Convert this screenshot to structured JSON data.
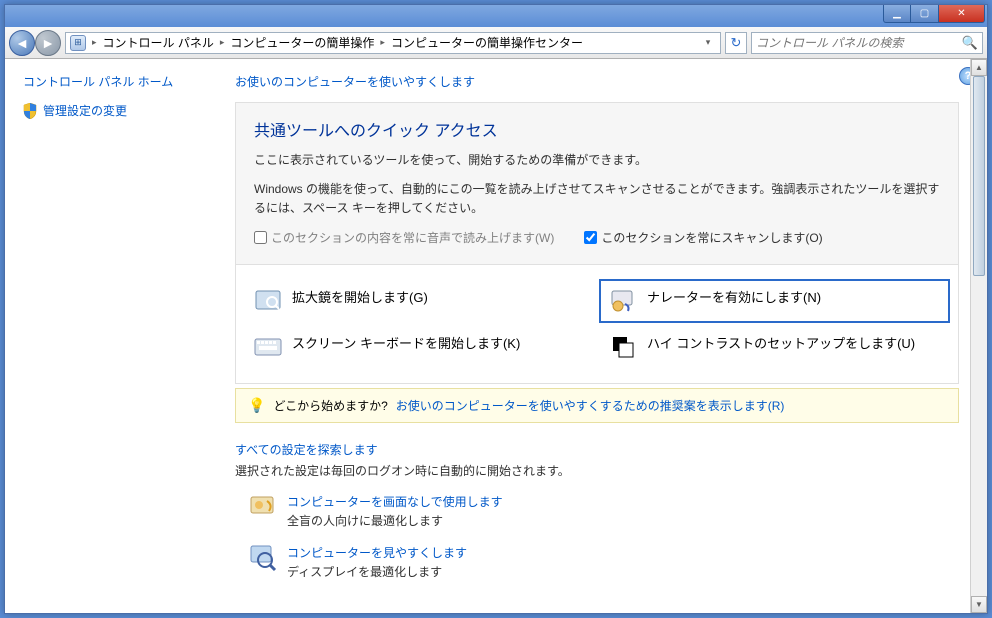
{
  "titlebar": {},
  "breadcrumb": {
    "root": "コントロール パネル",
    "level1": "コンピューターの簡単操作",
    "level2": "コンピューターの簡単操作センター"
  },
  "search": {
    "placeholder": "コントロール パネルの検索"
  },
  "sidebar": {
    "home": "コントロール パネル ホーム",
    "admin": "管理設定の変更"
  },
  "main": {
    "intro": "お使いのコンピューターを使いやすくします",
    "quick": {
      "title": "共通ツールへのクイック アクセス",
      "desc1": "ここに表示されているツールを使って、開始するための準備ができます。",
      "desc2": "Windows の機能を使って、自動的にこの一覧を読み上げさせてスキャンさせることができます。強調表示されたツールを選択するには、スペース キーを押してください。",
      "chk_voice": "このセクションの内容を常に音声で読み上げます(W)",
      "chk_scan": "このセクションを常にスキャンします(O)"
    },
    "tools": {
      "magnifier": "拡大鏡を開始します(G)",
      "narrator": "ナレーターを有効にします(N)",
      "osk": "スクリーン キーボードを開始します(K)",
      "contrast": "ハイ コントラストのセットアップをします(U)"
    },
    "hint": {
      "q": "どこから始めますか?",
      "link": "お使いのコンピューターを使いやすくするための推奨案を表示します(R)"
    },
    "explore": {
      "title": "すべての設定を探索します",
      "desc": "選択された設定は毎回のログオン時に自動的に開始されます。",
      "nodisplay": {
        "link": "コンピューターを画面なしで使用します",
        "sub": "全盲の人向けに最適化します"
      },
      "easysee": {
        "link": "コンピューターを見やすくします",
        "sub": "ディスプレイを最適化します"
      }
    }
  }
}
